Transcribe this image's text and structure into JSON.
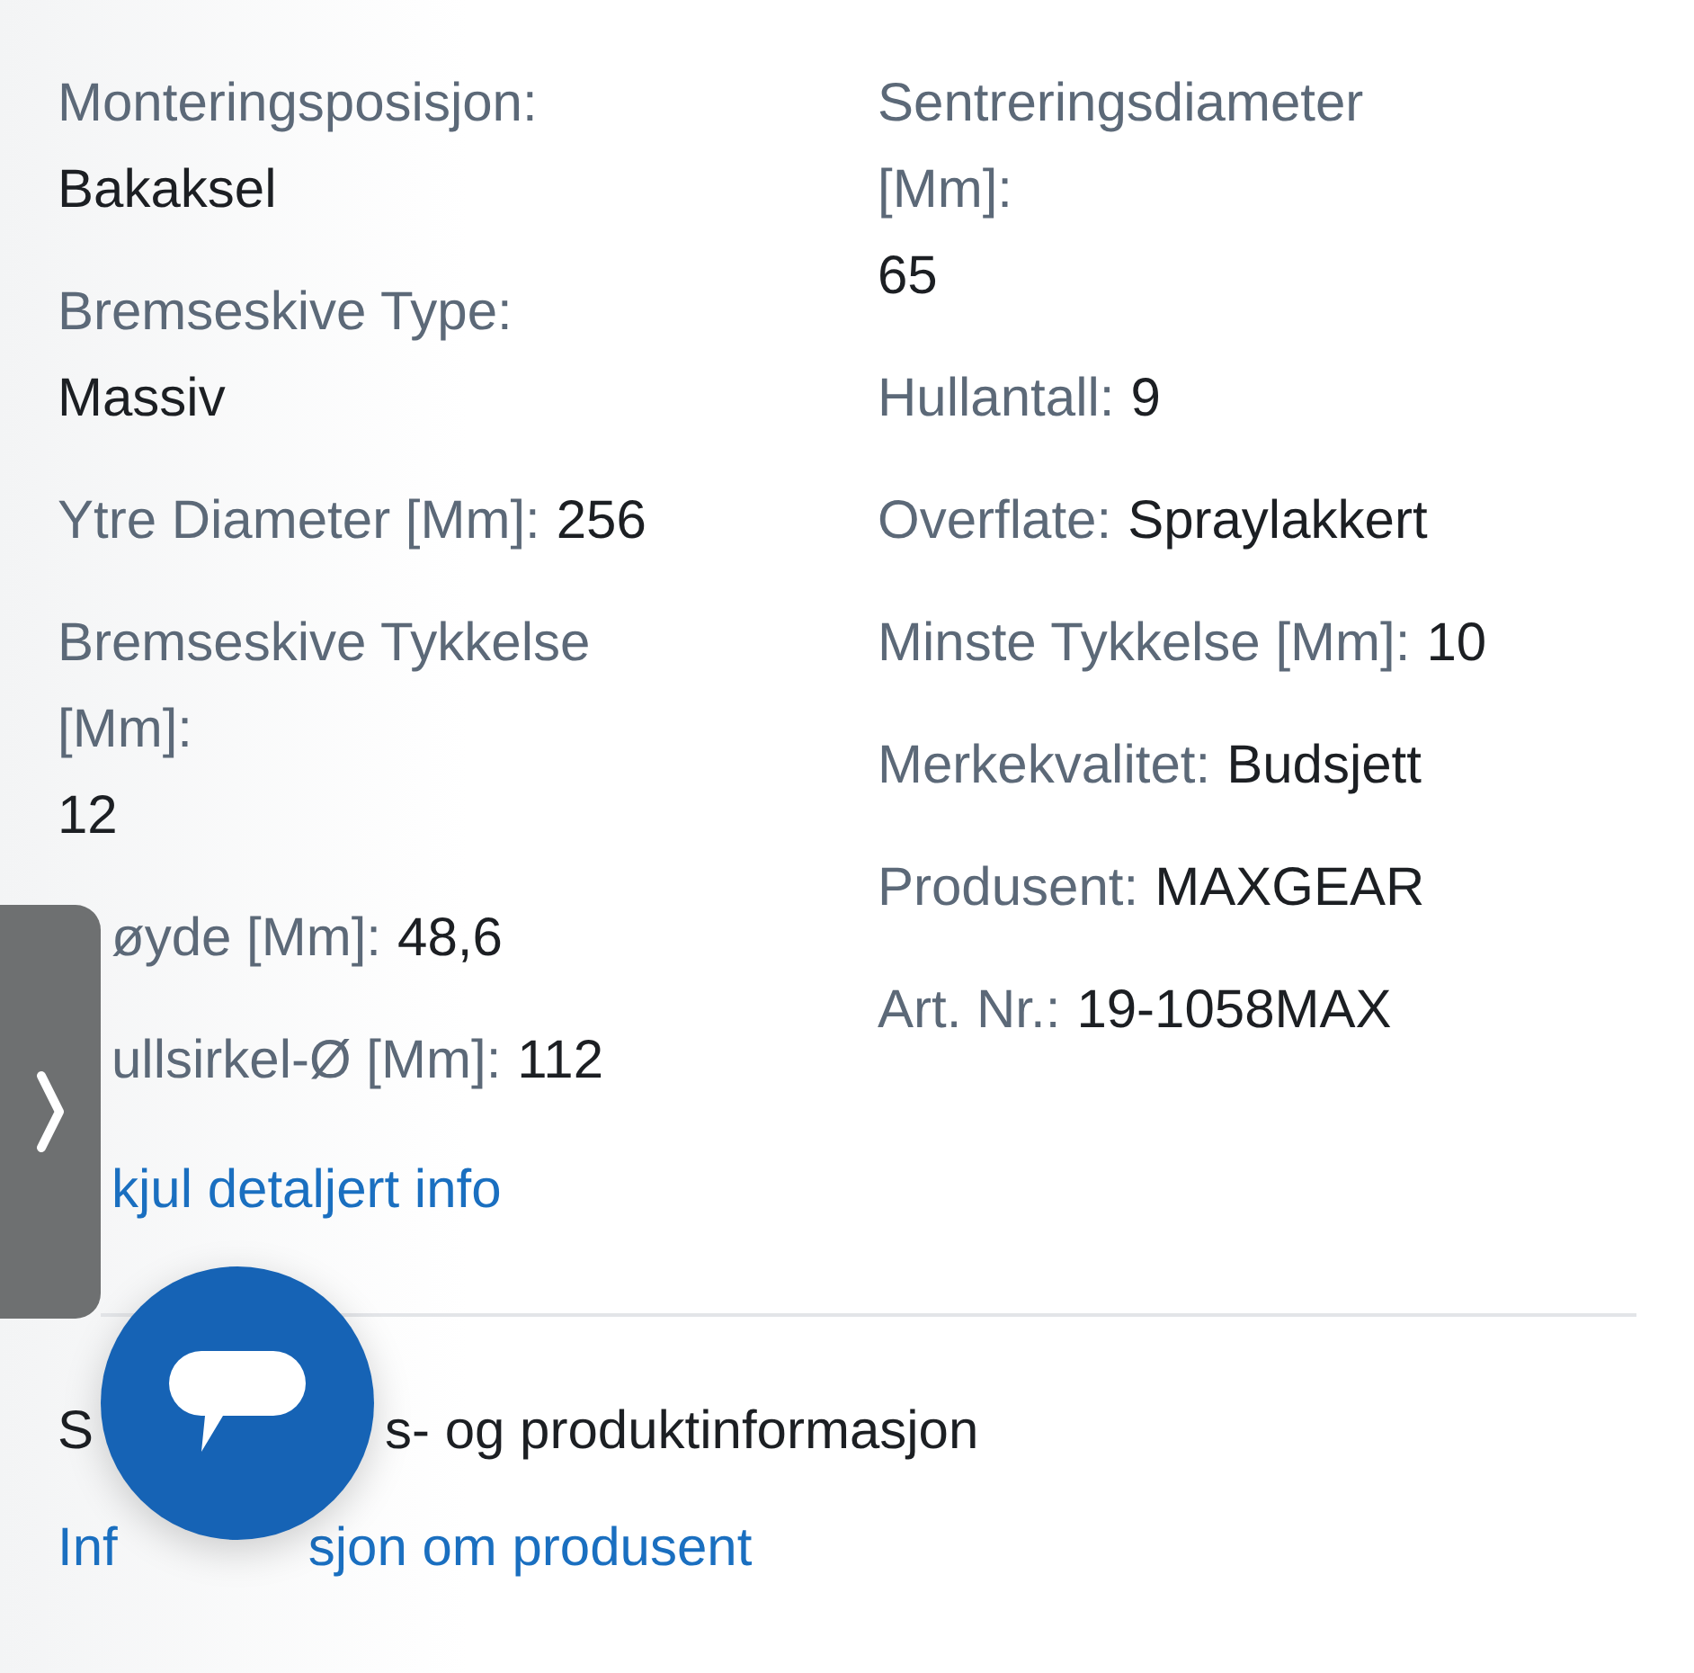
{
  "specs_left": [
    {
      "label": "Monteringsposisjon:",
      "value": "Bakaksel",
      "kind": "stacked"
    },
    {
      "label": "Bremseskive Type:",
      "value": "Massiv",
      "kind": "stacked"
    },
    {
      "label": "Ytre Diameter [Mm]:",
      "value": "256",
      "kind": "inline"
    },
    {
      "label": "Bremseskive Tykkelse [Mm]:",
      "value": "12",
      "kind": "stacked"
    },
    {
      "label": "øyde [Mm]:",
      "value": "48,6",
      "kind": "cut"
    },
    {
      "label": "ullsirkel-Ø [Mm]:",
      "value": "112",
      "kind": "cut"
    }
  ],
  "hide_details_link": "kjul detaljert info",
  "specs_right": [
    {
      "label": "Sentreringsdiameter [Mm]:",
      "value": "65",
      "kind": "stacked"
    },
    {
      "label": "Hullantall:",
      "value": "9",
      "kind": "inline"
    },
    {
      "label": "Overflate:",
      "value": "Spraylakkert",
      "kind": "inline"
    },
    {
      "label": "Minste Tykkelse [Mm]:",
      "value": "10",
      "kind": "inline"
    },
    {
      "label": "Merkekvalitet:",
      "value": "Budsjett",
      "kind": "inline"
    },
    {
      "label": "Produsent:",
      "value": "MAXGEAR",
      "kind": "inline"
    },
    {
      "label": "Art. Nr.:",
      "value": "19-1058MAX",
      "kind": "inline"
    }
  ],
  "section_heading": [
    "S",
    "s- og produktinformasjon"
  ],
  "manufacturer_link": [
    "Inf",
    "sjon om produsent"
  ]
}
